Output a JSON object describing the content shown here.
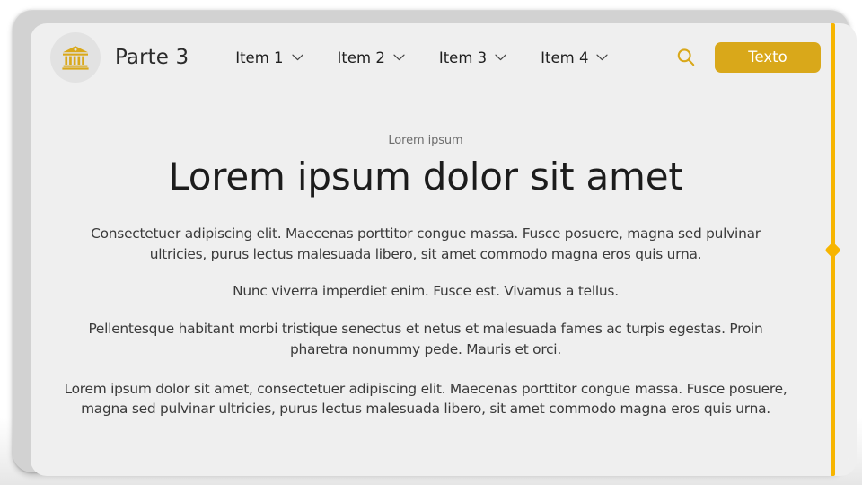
{
  "header": {
    "logo_icon": "bank-building-icon",
    "brand_title": "Parte 3",
    "nav_items": [
      {
        "label": "Item 1",
        "icon": "chevron-down-icon"
      },
      {
        "label": "Item 2",
        "icon": "chevron-down-icon"
      },
      {
        "label": "Item 3",
        "icon": "chevron-down-icon"
      },
      {
        "label": "Item 4",
        "icon": "chevron-down-icon"
      }
    ],
    "search_icon": "search-icon",
    "cta_label": "Texto"
  },
  "content": {
    "eyebrow": "Lorem ipsum",
    "headline": "Lorem ipsum dolor sit amet",
    "paragraphs": [
      "Consectetuer adipiscing elit. Maecenas porttitor congue massa. Fusce posuere, magna sed pulvinar ultricies, purus lectus malesuada libero, sit amet commodo magna eros quis urna.",
      "Nunc viverra imperdiet enim. Fusce est.  Vivamus a tellus.",
      "Pellentesque habitant morbi tristique senectus et netus et malesuada fames ac turpis egestas. Proin pharetra nonummy pede. Mauris et orci.",
      "Lorem ipsum dolor sit amet, consectetuer adipiscing elit. Maecenas porttitor congue massa. Fusce posuere, magna sed pulvinar ultricies, purus lectus malesuada libero, sit amet commodo magna eros quis urna."
    ]
  },
  "rail": {
    "name": "vertical-progress-rail",
    "handle_icon": "diamond-handle-icon"
  },
  "colors": {
    "accent": "#D9A81A",
    "rail": "#F7B500",
    "panel_bg": "#EFEFEF",
    "frame": "#D2D2D2",
    "heading": "#1C1C1C",
    "body": "#3A3A3A",
    "eyebrow": "#6D6D6D"
  }
}
